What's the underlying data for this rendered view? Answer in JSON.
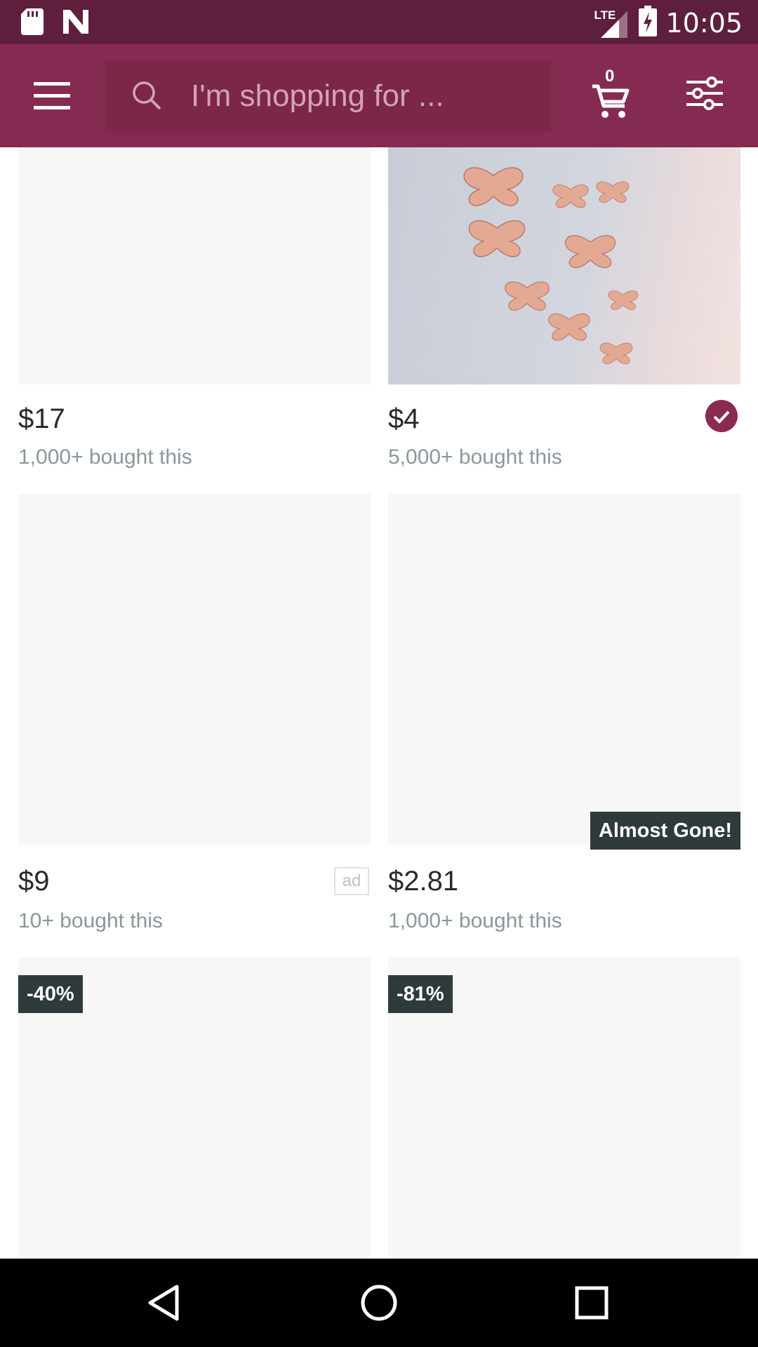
{
  "status_bar": {
    "network": "LTE",
    "time": "10:05"
  },
  "app_bar": {
    "search_placeholder": "I'm shopping for ...",
    "cart_count": "0"
  },
  "colors": {
    "status_bar": "#5e1f3d",
    "app_bar": "#852b52",
    "accent": "#8a2a53",
    "badge_dark": "#2f3a3c"
  },
  "products": [
    {
      "price": "$17",
      "sold": "1,000+ bought this"
    },
    {
      "price": "$4",
      "sold": "5,000+ bought this",
      "verified": true,
      "image": "rose gold butterfly wall decorations"
    },
    {
      "price": "$9",
      "sold": "10+ bought this",
      "ad": "ad"
    },
    {
      "price": "$2.81",
      "sold": "1,000+ bought this",
      "badge": "Almost Gone!"
    },
    {
      "discount": "-40%"
    },
    {
      "discount": "-81%"
    }
  ]
}
